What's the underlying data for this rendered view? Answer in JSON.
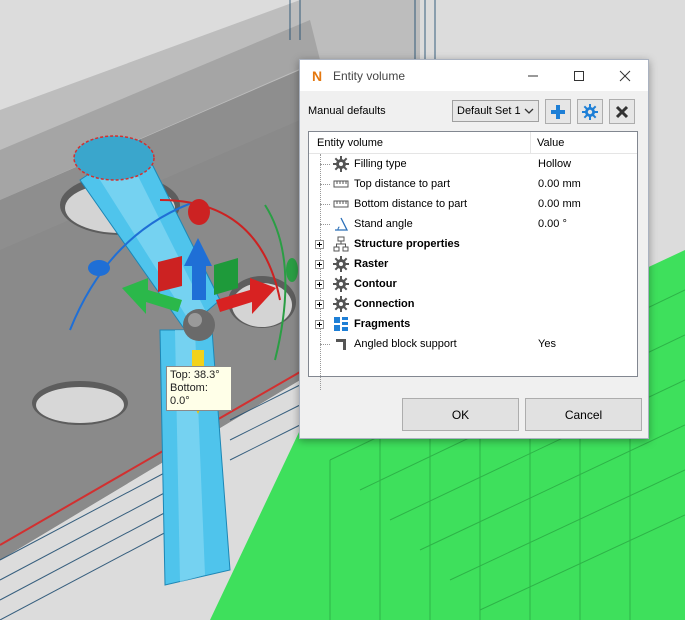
{
  "tooltip": {
    "top_line": "Top: 38.3°",
    "bottom_line": "Bottom: 0.0°"
  },
  "dialog": {
    "title": "Entity volume",
    "app_icon_letter": "N",
    "window_buttons": {
      "minimize": "—",
      "maximize": "☐",
      "close": "✕"
    }
  },
  "toolbar": {
    "label": "Manual defaults",
    "preset_value": "Default Set 1",
    "add_icon": "plus-icon",
    "settings_icon": "gear-icon",
    "delete_icon": "close-icon"
  },
  "tree": {
    "columns": {
      "name": "Entity volume",
      "value": "Value"
    },
    "rows": [
      {
        "name": "Filling type",
        "value": "Hollow",
        "icon": "gear-icon",
        "bold": false,
        "expandable": false
      },
      {
        "name": "Top distance to part",
        "value": "0.00 mm",
        "icon": "ruler-icon",
        "bold": false,
        "expandable": false
      },
      {
        "name": "Bottom distance to part",
        "value": "0.00 mm",
        "icon": "ruler-icon",
        "bold": false,
        "expandable": false
      },
      {
        "name": "Stand angle",
        "value": "0.00 °",
        "icon": "angle-icon",
        "bold": false,
        "expandable": false
      },
      {
        "name": "Structure properties",
        "value": "",
        "icon": "hierarchy-icon",
        "bold": true,
        "expandable": true
      },
      {
        "name": "Raster",
        "value": "",
        "icon": "gear-icon",
        "bold": true,
        "expandable": true
      },
      {
        "name": "Contour",
        "value": "",
        "icon": "gear-icon",
        "bold": true,
        "expandable": true
      },
      {
        "name": "Connection",
        "value": "",
        "icon": "gear-icon",
        "bold": true,
        "expandable": true
      },
      {
        "name": "Fragments",
        "value": "",
        "icon": "fragments-icon",
        "bold": true,
        "expandable": true
      },
      {
        "name": "Angled block support",
        "value": "Yes",
        "icon": "block-support-icon",
        "bold": false,
        "expandable": false
      }
    ]
  },
  "buttons": {
    "ok": "OK",
    "cancel": "Cancel"
  },
  "colors": {
    "support_blue": "#4fc4ec",
    "build_plate_green": "#33dd55",
    "part_gray": "#8e8e8e",
    "accent_blue": "#1e7fd6"
  }
}
